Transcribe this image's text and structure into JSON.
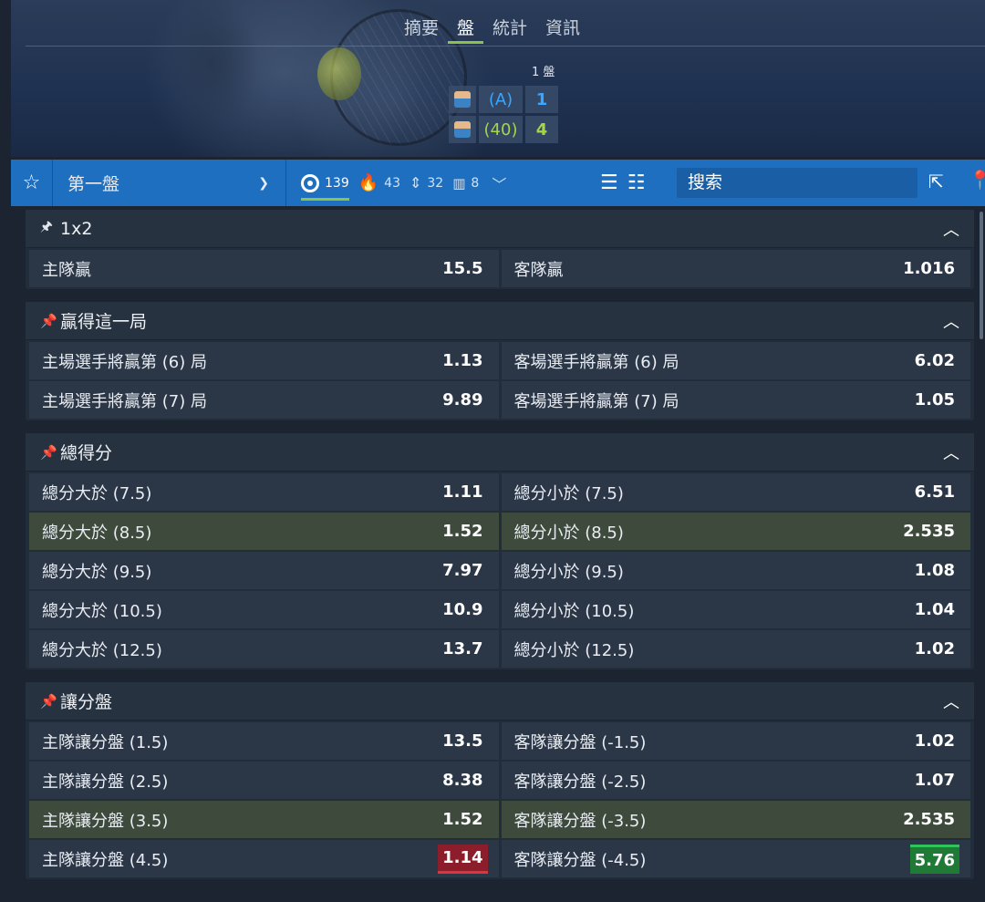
{
  "header": {
    "tabs": [
      {
        "label": "摘要",
        "active": false
      },
      {
        "label": "盤",
        "active": true
      },
      {
        "label": "統計",
        "active": false
      },
      {
        "label": "資訊",
        "active": false
      }
    ],
    "set_label": "1 盤",
    "players": [
      {
        "points": "(A)",
        "games": "1"
      },
      {
        "points": "(40)",
        "games": "4"
      }
    ]
  },
  "filter_bar": {
    "period": "第一盤",
    "counters": [
      {
        "icon": "target-icon",
        "count": "139",
        "active": true
      },
      {
        "icon": "fire-icon",
        "count": "43",
        "active": false
      },
      {
        "icon": "updown-arrows-icon",
        "count": "32",
        "active": false
      },
      {
        "icon": "bar-chart-icon",
        "count": "8",
        "active": false
      }
    ],
    "search_placeholder": "搜索",
    "colors": {
      "bar": "#1e6fc0",
      "active_underline": "#8bc34a"
    }
  },
  "markets": [
    {
      "title": "1x2",
      "rows": [
        [
          {
            "name": "主隊贏",
            "odd": "15.5"
          },
          {
            "name": "客隊贏",
            "odd": "1.016"
          }
        ]
      ]
    },
    {
      "title": "贏得這一局",
      "rows": [
        [
          {
            "name": "主場選手將贏第 (6) 局",
            "odd": "1.13"
          },
          {
            "name": "客場選手將贏第 (6) 局",
            "odd": "6.02"
          }
        ],
        [
          {
            "name": "主場選手將贏第 (7) 局",
            "odd": "9.89"
          },
          {
            "name": "客場選手將贏第 (7) 局",
            "odd": "1.05"
          }
        ]
      ]
    },
    {
      "title": "總得分",
      "rows": [
        [
          {
            "name": "總分大於 (7.5)",
            "odd": "1.11"
          },
          {
            "name": "總分小於 (7.5)",
            "odd": "6.51"
          }
        ],
        [
          {
            "name": "總分大於 (8.5)",
            "odd": "1.52",
            "highlight": true
          },
          {
            "name": "總分小於 (8.5)",
            "odd": "2.535",
            "highlight": true
          }
        ],
        [
          {
            "name": "總分大於 (9.5)",
            "odd": "7.97"
          },
          {
            "name": "總分小於 (9.5)",
            "odd": "1.08"
          }
        ],
        [
          {
            "name": "總分大於 (10.5)",
            "odd": "10.9"
          },
          {
            "name": "總分小於 (10.5)",
            "odd": "1.04"
          }
        ],
        [
          {
            "name": "總分大於 (12.5)",
            "odd": "13.7"
          },
          {
            "name": "總分小於 (12.5)",
            "odd": "1.02"
          }
        ]
      ]
    },
    {
      "title": "讓分盤",
      "rows": [
        [
          {
            "name": "主隊讓分盤 (1.5)",
            "odd": "13.5"
          },
          {
            "name": "客隊讓分盤 (-1.5)",
            "odd": "1.02"
          }
        ],
        [
          {
            "name": "主隊讓分盤 (2.5)",
            "odd": "8.38"
          },
          {
            "name": "客隊讓分盤 (-2.5)",
            "odd": "1.07"
          }
        ],
        [
          {
            "name": "主隊讓分盤 (3.5)",
            "odd": "1.52",
            "highlight": true
          },
          {
            "name": "客隊讓分盤 (-3.5)",
            "odd": "2.535",
            "highlight": true
          }
        ],
        [
          {
            "name": "主隊讓分盤 (4.5)",
            "odd": "1.14",
            "trend": "down"
          },
          {
            "name": "客隊讓分盤 (-4.5)",
            "odd": "5.76",
            "trend": "up"
          }
        ]
      ]
    }
  ]
}
